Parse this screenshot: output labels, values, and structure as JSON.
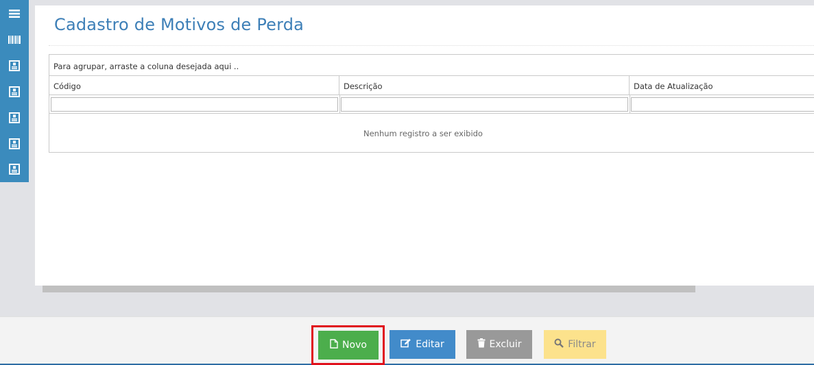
{
  "sidebar": {
    "items": [
      {
        "icon": "menu-icon"
      },
      {
        "icon": "barcode-icon"
      },
      {
        "icon": "form-icon"
      },
      {
        "icon": "form-icon"
      },
      {
        "icon": "form-icon"
      },
      {
        "icon": "form-icon"
      },
      {
        "icon": "form-icon"
      }
    ]
  },
  "page": {
    "title": "Cadastro de Motivos de Perda"
  },
  "grid": {
    "group_panel_text": "Para agrupar, arraste a coluna desejada aqui ..",
    "columns": [
      "Código",
      "Descrição",
      "Data de Atualização"
    ],
    "empty_message": "Nenhum registro a ser exibido"
  },
  "toolbar": {
    "novo_label": "Novo",
    "editar_label": "Editar",
    "excluir_label": "Excluir",
    "filtrar_label": "Filtrar",
    "colors": {
      "novo": "#4cae4c",
      "editar": "#428bca",
      "excluir": "#999999",
      "filtrar": "#fce28c",
      "highlight": "#e0101c"
    }
  }
}
